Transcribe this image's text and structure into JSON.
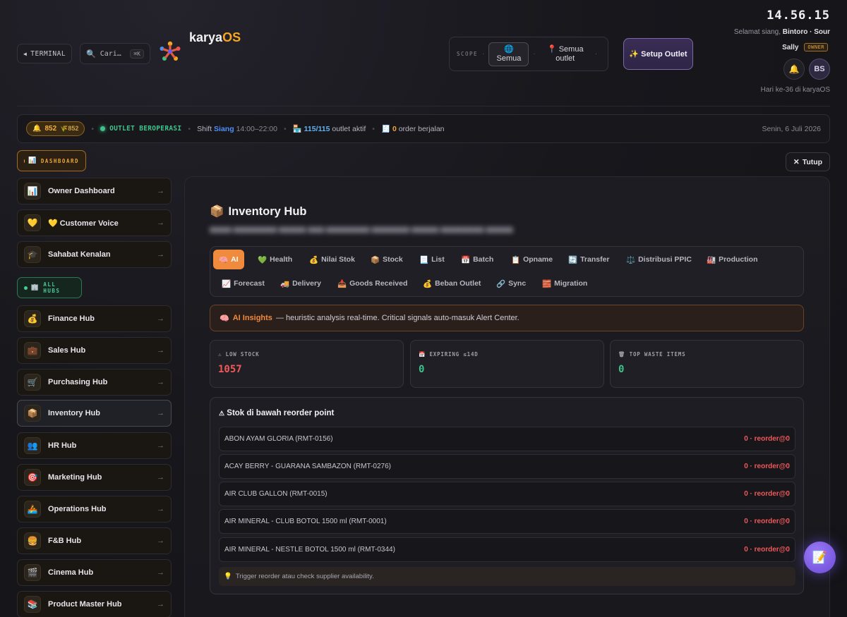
{
  "header": {
    "terminal_label": "TERMINAL",
    "search_placeholder": "Cari…",
    "search_shortcut": "⌘K",
    "brand_main": "karya",
    "brand_accent": "OS",
    "scope_label": "SCOPE",
    "scope_options": [
      {
        "icon": "globe-icon",
        "label": "Semua"
      },
      {
        "icon": "pin-icon",
        "label": "Semua outlet"
      }
    ],
    "setup_button": "✨ Setup Outlet",
    "clock": "14.56.15",
    "greeting_prefix": "Selamat siang,",
    "greeting_name": "Bintoro · Sour",
    "user_name": "Sally",
    "user_role": "OWNER",
    "avatar_initials": "BS",
    "day_count": "Hari ke-36 di karyaOS"
  },
  "status_bar": {
    "alert_count": "852",
    "alert_sub": "852",
    "operating": "OUTLET BEROPERASI",
    "shift_prefix": "Shift",
    "shift_name": "Siang",
    "shift_time": "14:00–22:00",
    "outlet_count": "115/115",
    "outlet_suffix": "outlet aktif",
    "orders_count": "0",
    "orders_suffix": "order berjalan",
    "date": "Senin, 6 Juli 2026"
  },
  "sidebar": {
    "dashboard_chip": "DASHBOARD",
    "dashboard_items": [
      {
        "icon": "📊",
        "label": "Owner Dashboard"
      },
      {
        "icon": "💛",
        "label": "💛 Customer Voice"
      },
      {
        "icon": "🎓",
        "label": "Sahabat Kenalan"
      }
    ],
    "hubs_chip": "ALL HUBS",
    "hub_items": [
      {
        "icon": "💰",
        "label": "Finance Hub"
      },
      {
        "icon": "💼",
        "label": "Sales Hub"
      },
      {
        "icon": "🛒",
        "label": "Purchasing Hub"
      },
      {
        "icon": "📦",
        "label": "Inventory Hub"
      },
      {
        "icon": "👥",
        "label": "HR Hub"
      },
      {
        "icon": "🎯",
        "label": "Marketing Hub"
      },
      {
        "icon": "🚣",
        "label": "Operations Hub"
      },
      {
        "icon": "🍔",
        "label": "F&B Hub"
      },
      {
        "icon": "🎬",
        "label": "Cinema Hub"
      },
      {
        "icon": "📚",
        "label": "Product Master Hub"
      }
    ]
  },
  "main": {
    "close_label": "Tutup",
    "title": "Inventory Hub",
    "tabs": [
      {
        "icon": "🧠",
        "label": "AI"
      },
      {
        "icon": "💚",
        "label": "Health"
      },
      {
        "icon": "💰",
        "label": "Nilai Stok"
      },
      {
        "icon": "📦",
        "label": "Stock"
      },
      {
        "icon": "📃",
        "label": "List"
      },
      {
        "icon": "📅",
        "label": "Batch"
      },
      {
        "icon": "📋",
        "label": "Opname"
      },
      {
        "icon": "🔄",
        "label": "Transfer"
      },
      {
        "icon": "⚖️",
        "label": "Distribusi PPIC"
      },
      {
        "icon": "🏭",
        "label": "Production"
      },
      {
        "icon": "📈",
        "label": "Forecast"
      },
      {
        "icon": "🚚",
        "label": "Delivery"
      },
      {
        "icon": "📥",
        "label": "Goods Received"
      },
      {
        "icon": "💰",
        "label": "Beban Outlet"
      },
      {
        "icon": "🔗",
        "label": "Sync"
      },
      {
        "icon": "🧱",
        "label": "Migration"
      }
    ],
    "insight_label": "AI Insights",
    "insight_text": "— heuristic analysis real-time. Critical signals auto-masuk Alert Center.",
    "stats": [
      {
        "icon": "⚠",
        "label": "LOW STOCK",
        "value": "1057"
      },
      {
        "icon": "📅",
        "label": "EXPIRING ≤14D",
        "value": "0"
      },
      {
        "icon": "🗑",
        "label": "TOP WASTE ITEMS",
        "value": "0"
      }
    ],
    "reorder_title": "Stok di bawah reorder point",
    "reorder_rows": [
      {
        "name": "ABON AYAM GLORIA (RMT-0156)",
        "value": "0 · reorder@0"
      },
      {
        "name": "ACAY BERRY - GUARANA SAMBAZON (RMT-0276)",
        "value": "0 · reorder@0"
      },
      {
        "name": "AIR CLUB GALLON (RMT-0015)",
        "value": "0 · reorder@0"
      },
      {
        "name": "AIR MINERAL - CLUB BOTOL 1500 ml (RMT-0001)",
        "value": "0 · reorder@0"
      },
      {
        "name": "AIR MINERAL - NESTLE BOTOL 1500 ml (RMT-0344)",
        "value": "0 · reorder@0"
      }
    ],
    "hint": "Trigger reorder atau check supplier availability."
  },
  "colors": {
    "accent_orange": "#f08a3c",
    "brand_os": "#f6a623",
    "status_green": "#3ec28a",
    "alert_red": "#f0595a"
  }
}
